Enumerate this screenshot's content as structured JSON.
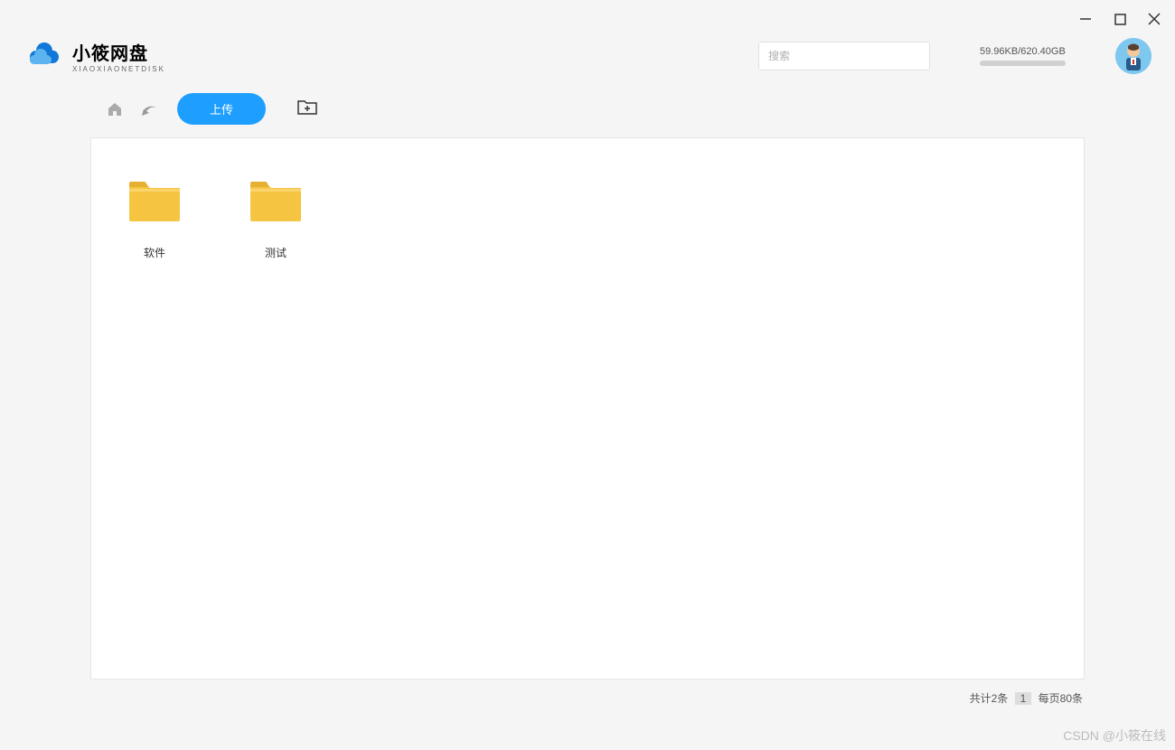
{
  "app": {
    "title": "小筱网盘",
    "subtitle": "XIAOXIAONETDISK"
  },
  "search": {
    "placeholder": "搜索"
  },
  "storage": {
    "label": "59.96KB/620.40GB"
  },
  "toolbar": {
    "upload_label": "上传"
  },
  "folders": [
    {
      "name": "软件"
    },
    {
      "name": "测试"
    }
  ],
  "footer": {
    "total_prefix": "共计",
    "total_count": "2条",
    "page_number": "1",
    "per_page": "每页80条"
  },
  "watermark": "CSDN @小筱在线"
}
